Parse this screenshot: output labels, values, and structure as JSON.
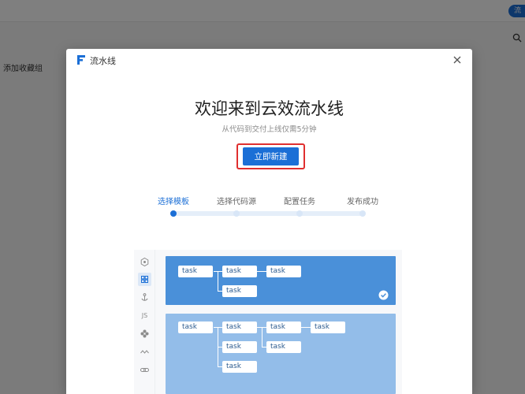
{
  "background": {
    "top_button_label": "流",
    "favorites_label": "添加收藏组"
  },
  "modal": {
    "title": "流水线",
    "heading": "欢迎来到云效流水线",
    "subtitle": "从代码到交付上线仅需5分钟",
    "create_button": "立即新建"
  },
  "steps": [
    {
      "label": "选择模板",
      "active": true
    },
    {
      "label": "选择代码源",
      "active": false
    },
    {
      "label": "配置任务",
      "active": false
    },
    {
      "label": "发布成功",
      "active": false
    }
  ],
  "rail": {
    "items": [
      "scan-icon",
      "grid-icon",
      "anchor-icon",
      "JS",
      "puzzle-icon",
      "wave-icon",
      "link-icon"
    ],
    "js_label": "JS"
  },
  "templates": {
    "task_label": "task",
    "selected_index": 0
  },
  "colors": {
    "accent": "#1b6fd6",
    "highlight": "#e02f2f",
    "template_selected": "#4a90d9",
    "template_plain": "#93bde9"
  }
}
